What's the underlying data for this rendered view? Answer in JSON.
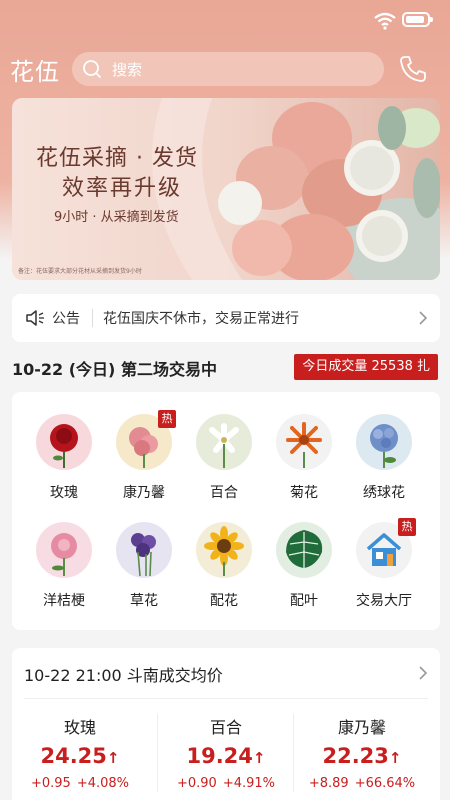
{
  "header": {
    "logo": "花伍",
    "search_placeholder": "搜索"
  },
  "banner": {
    "title_line1": "花伍采摘 · 发货",
    "title_line2": "效率再升级",
    "subtitle": "9小时 · 从采摘到发货",
    "note": "备注：花伍要求大部分花材从采摘到发货9小时"
  },
  "notice": {
    "label": "公告",
    "text": "花伍国庆不休市，交易正常进行"
  },
  "session": {
    "title": "10-22 (今日) 第二场交易中",
    "volume": "今日成交量 25538 扎"
  },
  "categories": [
    {
      "label": "玫瑰",
      "hot": false
    },
    {
      "label": "康乃馨",
      "hot": true,
      "hot_text": "热"
    },
    {
      "label": "百合",
      "hot": false
    },
    {
      "label": "菊花",
      "hot": false
    },
    {
      "label": "绣球花",
      "hot": false
    },
    {
      "label": "洋桔梗",
      "hot": false
    },
    {
      "label": "草花",
      "hot": false
    },
    {
      "label": "配花",
      "hot": false
    },
    {
      "label": "配叶",
      "hot": false
    },
    {
      "label": "交易大厅",
      "hot": true,
      "hot_text": "热"
    }
  ],
  "prices": {
    "title": "10-22 21:00 斗南成交均价",
    "items": [
      {
        "name": "玫瑰",
        "price": "24.25",
        "change": "+0.95",
        "percent": "+4.08%"
      },
      {
        "name": "百合",
        "price": "19.24",
        "change": "+0.90",
        "percent": "+4.91%"
      },
      {
        "name": "康乃馨",
        "price": "22.23",
        "change": "+8.89",
        "percent": "+66.64%"
      }
    ]
  },
  "colors": {
    "accent_red": "#c81e1e",
    "header_pink": "#e9a795"
  }
}
